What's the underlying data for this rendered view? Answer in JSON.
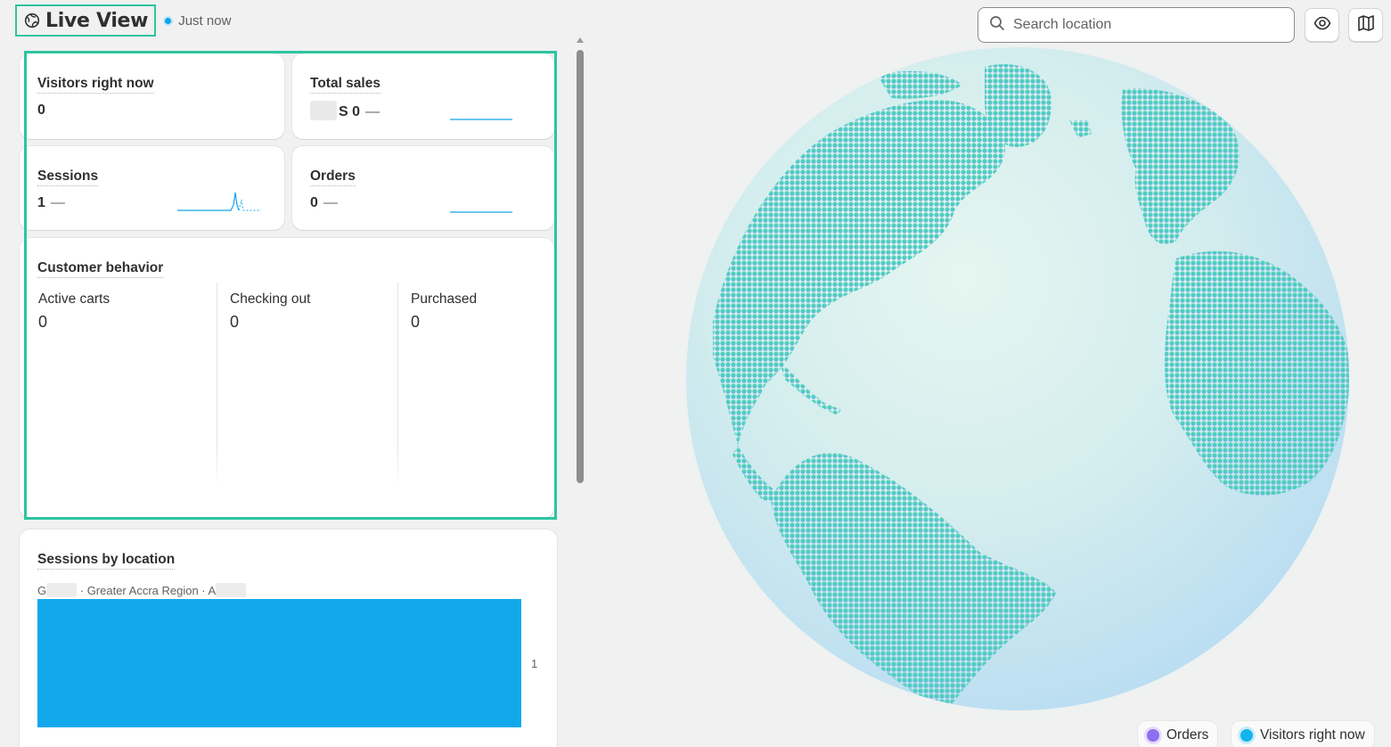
{
  "header": {
    "title": "Live View",
    "status": "Just now"
  },
  "metrics": {
    "visitors": {
      "label": "Visitors right now",
      "value": "0"
    },
    "total_sales": {
      "label": "Total sales",
      "value": "S 0",
      "change": "—"
    },
    "sessions": {
      "label": "Sessions",
      "value": "1",
      "change": "—"
    },
    "orders": {
      "label": "Orders",
      "value": "0",
      "change": "—"
    }
  },
  "customer_behavior": {
    "title": "Customer behavior",
    "columns": [
      {
        "label": "Active carts",
        "value": "0"
      },
      {
        "label": "Checking out",
        "value": "0"
      },
      {
        "label": "Purchased",
        "value": "0"
      }
    ]
  },
  "sessions_by_location": {
    "title": "Sessions by location",
    "location_prefix": "G",
    "location_region": "· Greater Accra Region · A",
    "count": "1"
  },
  "search": {
    "placeholder": "Search location"
  },
  "icons": {
    "title": "globe-icon",
    "status": "live-dot-icon",
    "search": "search-icon",
    "visibility": "eye-icon",
    "map": "map-icon"
  },
  "legend": {
    "orders": "Orders",
    "visitors": "Visitors right now"
  },
  "colors": {
    "accent": "#13a3e6",
    "highlight": "#2ec4a0",
    "orders_dot": "#8d6ff0",
    "visitors_dot": "#13b4ec",
    "land": "#4fd8b8"
  }
}
